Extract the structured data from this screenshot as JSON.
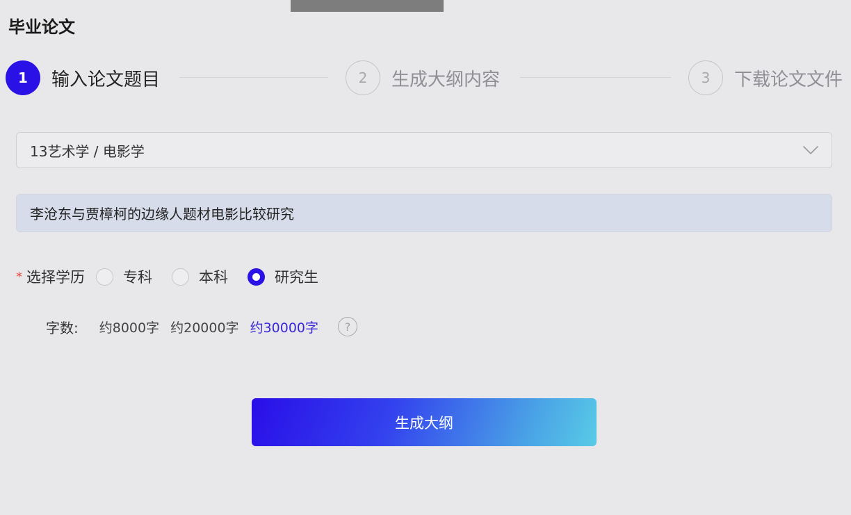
{
  "page": {
    "title": "毕业论文"
  },
  "steps": [
    {
      "number": "1",
      "label": "输入论文题目",
      "state": "active"
    },
    {
      "number": "2",
      "label": "生成大纲内容",
      "state": "inactive"
    },
    {
      "number": "3",
      "label": "下载论文文件",
      "state": "inactive"
    }
  ],
  "subject_select": {
    "value": "13艺术学 / 电影学",
    "icon": "chevron-down-icon"
  },
  "topic_input": {
    "value": "李沧东与贾樟柯的边缘人题材电影比较研究"
  },
  "education": {
    "required_mark": "*",
    "label": "选择学历",
    "options": [
      {
        "label": "专科",
        "checked": false
      },
      {
        "label": "本科",
        "checked": false
      },
      {
        "label": "研究生",
        "checked": true
      }
    ]
  },
  "word_count": {
    "label": "字数:",
    "options": [
      {
        "label": "约8000字",
        "selected": false
      },
      {
        "label": "约20000字",
        "selected": false
      },
      {
        "label": "约30000字",
        "selected": true
      }
    ],
    "help_glyph": "?"
  },
  "actions": {
    "generate_label": "生成大纲"
  },
  "colors": {
    "accent": "#2a12e6",
    "selected_text": "#3a28d8",
    "required": "#e84b3c",
    "button_gradient_start": "#2a0ee8",
    "button_gradient_end": "#58cbe6"
  }
}
